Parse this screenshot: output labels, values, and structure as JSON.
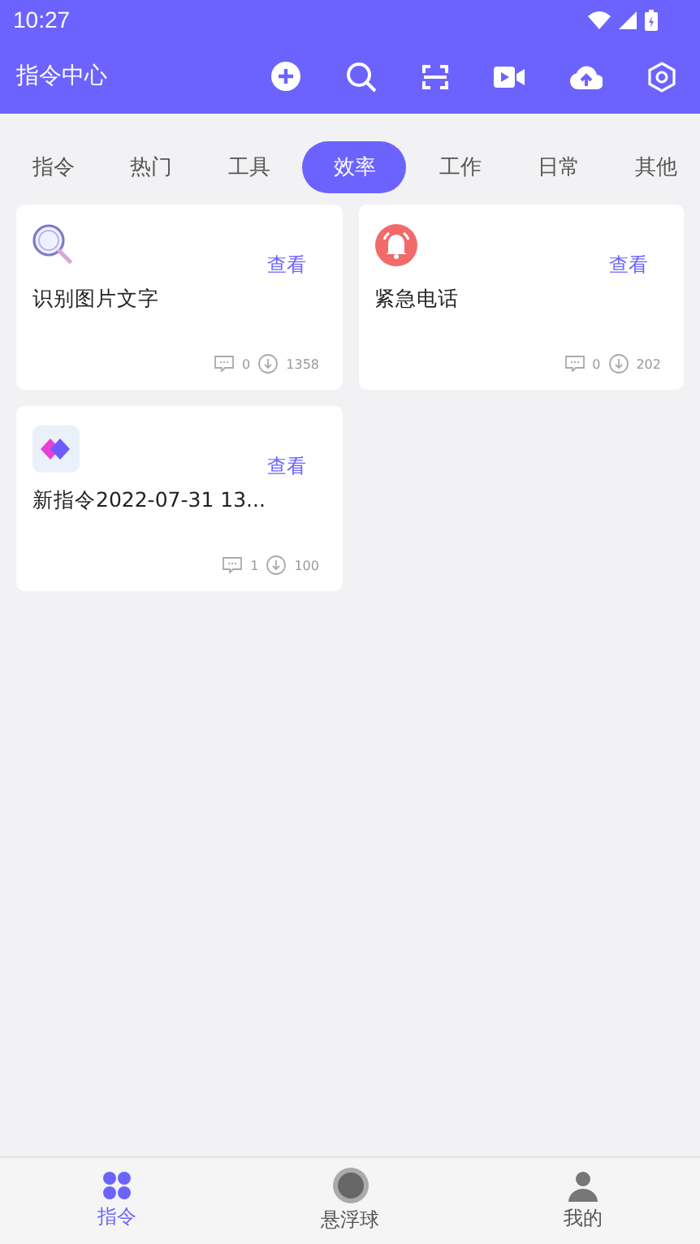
{
  "status_bar": {
    "time": "10:27"
  },
  "app_bar": {
    "title": "指令中心"
  },
  "tabs": [
    {
      "label": "指令",
      "selected": false
    },
    {
      "label": "热门",
      "selected": false
    },
    {
      "label": "工具",
      "selected": false
    },
    {
      "label": "效率",
      "selected": true
    },
    {
      "label": "工作",
      "selected": false
    },
    {
      "label": "日常",
      "selected": false
    },
    {
      "label": "其他",
      "selected": false
    }
  ],
  "cards": [
    {
      "kind": "ocr",
      "title": "识别图片文字",
      "action": "查看",
      "comments": "0",
      "downloads": "1358"
    },
    {
      "kind": "bell",
      "title": "紧急电话",
      "action": "查看",
      "comments": "0",
      "downloads": "202"
    },
    {
      "kind": "diamond",
      "title": "新指令2022-07-31 13...",
      "action": "查看",
      "comments": "1",
      "downloads": "100"
    }
  ],
  "bottom_nav": [
    {
      "kind": "grid",
      "label": "指令",
      "selected": true
    },
    {
      "kind": "ball",
      "label": "悬浮球",
      "selected": false
    },
    {
      "kind": "person",
      "label": "我的",
      "selected": false
    }
  ]
}
